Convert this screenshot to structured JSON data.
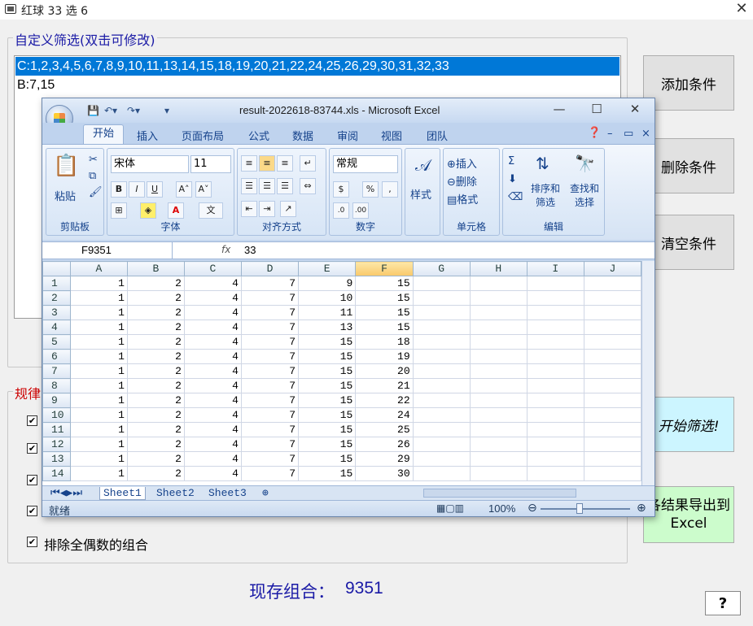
{
  "app": {
    "title": "红球 33 选 6",
    "close": "✕"
  },
  "custom_filter": {
    "legend": "自定义筛选(双击可修改)",
    "conditions": [
      "C:1,2,3,4,5,6,7,8,9,10,11,13,14,15,18,19,20,21,22,24,25,26,29,30,31,32,33",
      "B:7,15"
    ],
    "selected_index": 0
  },
  "rules": {
    "legend": "规律",
    "checkbox_mark": "✔",
    "visible_item_label": "排除全偶数的组合"
  },
  "buttons": {
    "add": "添加条件",
    "delete": "删除条件",
    "clear": "清空条件",
    "start": "开始筛选!",
    "export": "导结果导出到\nExcel",
    "export_line1": "各结果导出到",
    "export_line2": "Excel",
    "help": "?"
  },
  "status": {
    "label": "现存组合：",
    "value": "9351"
  },
  "excel": {
    "doc_title": "result-2022618-83744.xls - Microsoft Excel",
    "window_controls": [
      "—",
      "☐",
      "✕"
    ],
    "tabs": [
      "开始",
      "插入",
      "页面布局",
      "公式",
      "数据",
      "审阅",
      "视图",
      "团队"
    ],
    "ribbon": {
      "clipboard": {
        "label": "剪贴板",
        "paste": "粘贴"
      },
      "font": {
        "label": "字体",
        "font_name": "宋体",
        "font_size": "11"
      },
      "alignment": {
        "label": "对齐方式"
      },
      "number": {
        "label": "数字",
        "format": "常规"
      },
      "styles": {
        "label": "样式"
      },
      "cells": {
        "label": "单元格",
        "insert": "插入",
        "delete": "删除",
        "format": "格式"
      },
      "editing": {
        "label": "编辑",
        "sort": "排序和筛选",
        "find": "查找和选择"
      }
    },
    "name_box": "F9351",
    "formula_value": "33",
    "columns": [
      "A",
      "B",
      "C",
      "D",
      "E",
      "F",
      "G",
      "H",
      "I",
      "J"
    ],
    "rows": [
      [
        1,
        2,
        4,
        7,
        9,
        15
      ],
      [
        1,
        2,
        4,
        7,
        10,
        15
      ],
      [
        1,
        2,
        4,
        7,
        11,
        15
      ],
      [
        1,
        2,
        4,
        7,
        13,
        15
      ],
      [
        1,
        2,
        4,
        7,
        15,
        18
      ],
      [
        1,
        2,
        4,
        7,
        15,
        19
      ],
      [
        1,
        2,
        4,
        7,
        15,
        20
      ],
      [
        1,
        2,
        4,
        7,
        15,
        21
      ],
      [
        1,
        2,
        4,
        7,
        15,
        22
      ],
      [
        1,
        2,
        4,
        7,
        15,
        24
      ],
      [
        1,
        2,
        4,
        7,
        15,
        25
      ],
      [
        1,
        2,
        4,
        7,
        15,
        26
      ],
      [
        1,
        2,
        4,
        7,
        15,
        29
      ],
      [
        1,
        2,
        4,
        7,
        15,
        30
      ]
    ],
    "sheets": [
      "Sheet1",
      "Sheet2",
      "Sheet3"
    ],
    "status": "就绪",
    "zoom": "100%"
  }
}
